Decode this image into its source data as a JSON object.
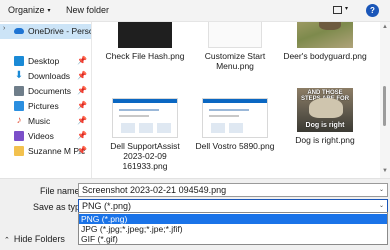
{
  "toolbar": {
    "organize_label": "Organize",
    "organize_caret": "▾",
    "new_folder_label": "New folder",
    "view_caret": "▾",
    "help_label": "?"
  },
  "nav": {
    "onedrive": {
      "label": "OneDrive - Person",
      "chevron": "›",
      "icon": "cloud-icon"
    },
    "items": [
      {
        "label": "Desktop",
        "icon": "desktop-icon",
        "pin": "📌"
      },
      {
        "label": "Downloads",
        "icon": "download-icon",
        "glyph": "⬇",
        "pin": "📌"
      },
      {
        "label": "Documents",
        "icon": "documents-icon",
        "pin": "📌"
      },
      {
        "label": "Pictures",
        "icon": "pictures-icon",
        "pin": "📌"
      },
      {
        "label": "Music",
        "icon": "music-icon",
        "glyph": "♪",
        "pin": "📌"
      },
      {
        "label": "Videos",
        "icon": "videos-icon",
        "pin": "📌"
      },
      {
        "label": "Suzanne M Pic",
        "icon": "folder-icon",
        "pin": "📌"
      }
    ]
  },
  "files": [
    {
      "name": "Check File Hash.png"
    },
    {
      "name": "Customize Start Menu.png"
    },
    {
      "name": "Deer's bodyguard.png"
    },
    {
      "name": "Dell SupportAssist 2023-02-09 161933.png"
    },
    {
      "name": "Dell Vostro 5890.png"
    },
    {
      "name": "Dog is right.png",
      "caption_top": "AND THOSE STEPS ARE FOR",
      "caption_bottom": "Dog is right"
    }
  ],
  "bottom": {
    "file_name_label": "File name:",
    "file_name_value": "Screenshot 2023-02-21 094549.png",
    "save_type_label": "Save as type:",
    "save_type_value": "PNG (*.png)",
    "caret": "⌄",
    "hide_folders_label": "Hide Folders",
    "hide_folders_chevron": "⌃"
  },
  "dropdown": {
    "options": [
      "PNG (*.png)",
      "JPG (*.jpg;*.jpeg;*.jpe;*.jfif)",
      "GIF (*.gif)"
    ],
    "selected_index": 0
  },
  "colors": {
    "accent": "#1a73e8",
    "nav_selected": "#cce4f7",
    "onedrive_blue": "#1e74d3"
  }
}
